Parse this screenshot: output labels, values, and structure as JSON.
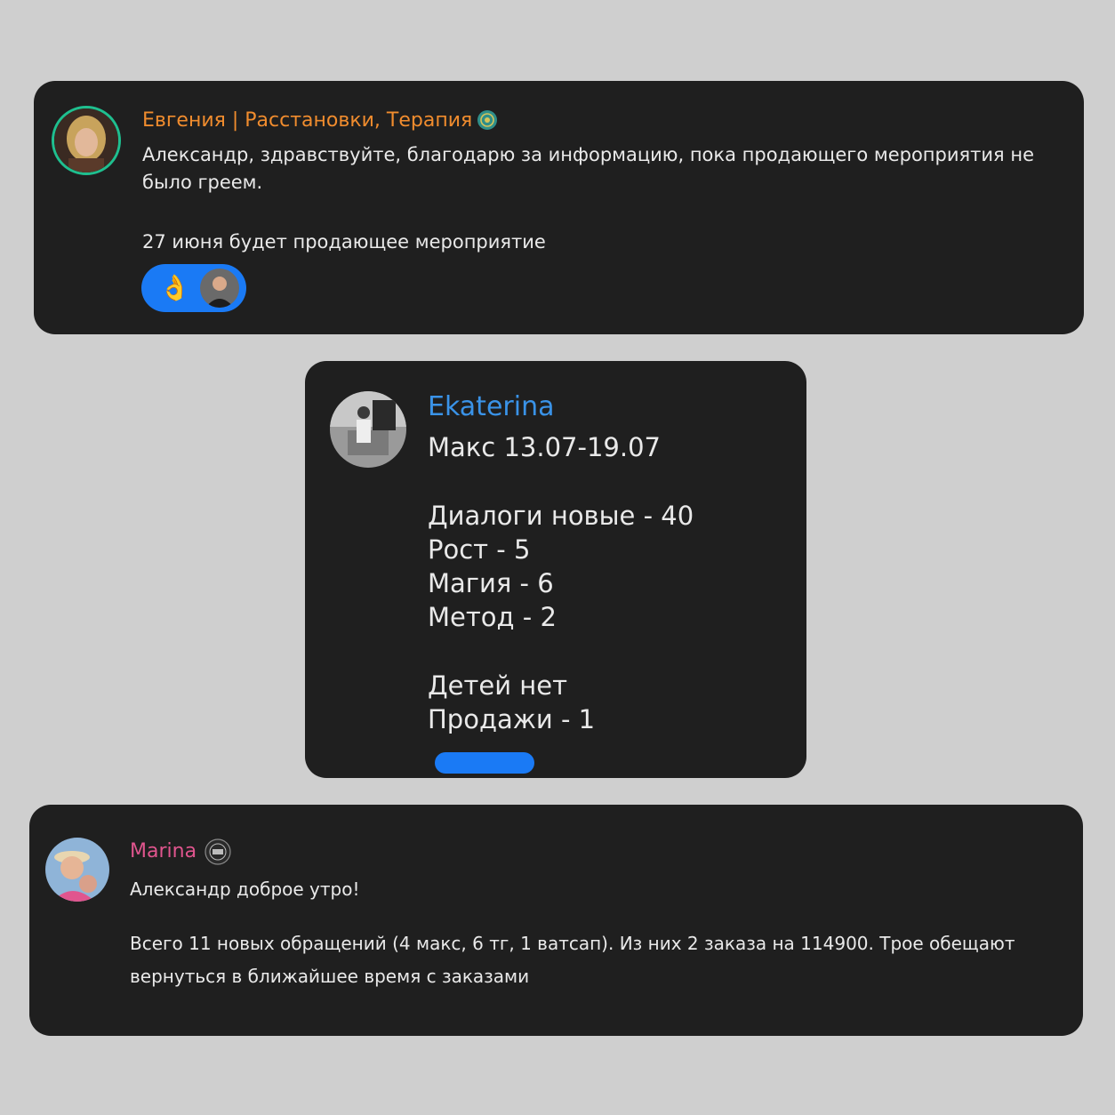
{
  "messages": [
    {
      "author": "Евгения | Расстановки, Терапия",
      "author_color": "#f08c2e",
      "badge_icon": "verified-seal-icon",
      "text_lines": [
        "Александр,   здравствуйте, благодарю за информацию, пока продающего мероприятия не было греем.",
        "27 июня будет продающее мероприятие"
      ],
      "reaction": {
        "emoji": "👌",
        "emoji_icon": "ok-hand-icon"
      }
    },
    {
      "author": "Ekaterina",
      "author_color": "#3a93e8",
      "text_lines": [
        "Макс 13.07-19.07",
        "",
        "Диалоги новые - 40",
        "Рост - 5",
        "Магия - 6",
        "Метод - 2",
        "",
        "Детей нет",
        "Продажи - 1"
      ]
    },
    {
      "author": "Marina",
      "author_color": "#e0558e",
      "badge_icon": "community-badge-icon",
      "text_lines": [
        "Александр доброе утро!",
        "Всего 11 новых обращений (4 макс, 6 тг, 1 ватсап). Из них 2 заказа на 114900. Трое обещают вернуться в ближайшее время с заказами"
      ]
    }
  ],
  "colors": {
    "page_background": "#cfcfcf",
    "card_background": "#1f1f1f",
    "message_text": "#e9e9e9",
    "reaction_pill": "#1a7af5",
    "avatar_ring": "#1fbf8f"
  }
}
